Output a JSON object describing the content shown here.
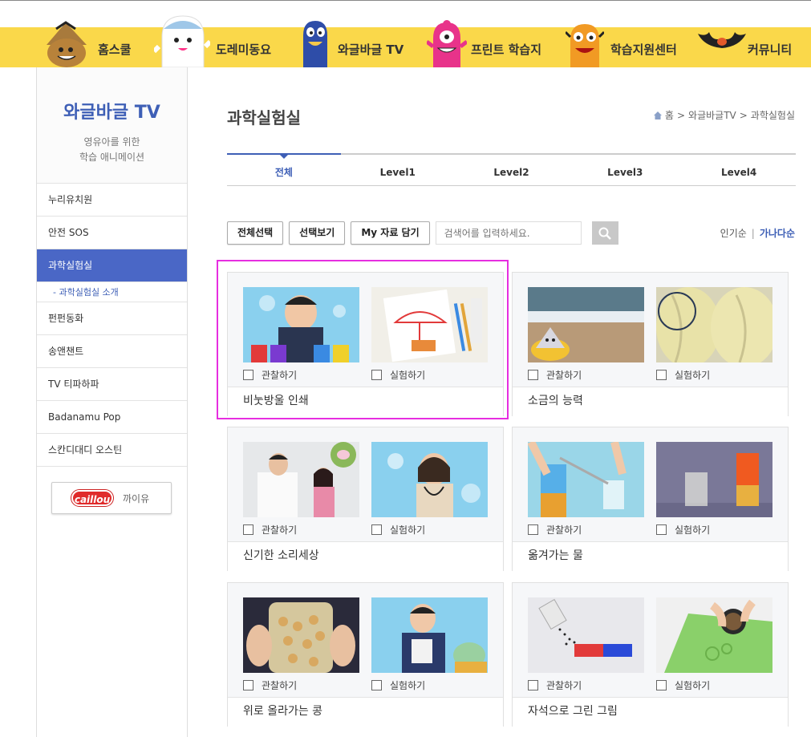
{
  "nav": {
    "items": [
      {
        "label": "홈스쿨"
      },
      {
        "label": "도레미동요"
      },
      {
        "label": "와글바글 TV"
      },
      {
        "label": "프린트 학습지"
      },
      {
        "label": "학습지원센터"
      },
      {
        "label": "커뮤니티"
      }
    ]
  },
  "sidebar": {
    "title": "와글바글 TV",
    "subtitle_line1": "영유아를 위한",
    "subtitle_line2": "학습 애니메이션",
    "items": [
      {
        "label": "누리유치원"
      },
      {
        "label": "안전 SOS"
      },
      {
        "label": "과학실험실"
      },
      {
        "label": "- 과학실험실 소개"
      },
      {
        "label": "펀펀동화"
      },
      {
        "label": "송앤챈트"
      },
      {
        "label": "TV 티파하파"
      },
      {
        "label": "Badanamu Pop"
      },
      {
        "label": "스칸디대디 오스틴"
      }
    ],
    "caillou_logo": "caillou",
    "caillou_label": "까이유"
  },
  "main": {
    "title": "과학실험실",
    "breadcrumb": [
      "홈",
      ">",
      "와글바글TV",
      ">",
      "과학실험실"
    ],
    "tabs": [
      "전체",
      "Level1",
      "Level2",
      "Level3",
      "Level4"
    ],
    "toolbar": {
      "select_all": "전체선택",
      "view_selected": "선택보기",
      "my_save": "My 자료 담기",
      "search_placeholder": "검색어를 입력하세요."
    },
    "sort": {
      "popular": "인기순",
      "alpha": "가나다순"
    },
    "check_observe": "관찰하기",
    "check_experiment": "실험하기",
    "cards": [
      {
        "name": "비눗방울 인쇄"
      },
      {
        "name": "소금의 능력"
      },
      {
        "name": "신기한 소리세상"
      },
      {
        "name": "옮겨가는 물"
      },
      {
        "name": "위로 올라가는 콩"
      },
      {
        "name": "자석으로 그린 그림"
      }
    ]
  },
  "colors": {
    "nav_bg": "#fad84a",
    "accent": "#4a67c6",
    "highlight": "#e62ee0"
  }
}
